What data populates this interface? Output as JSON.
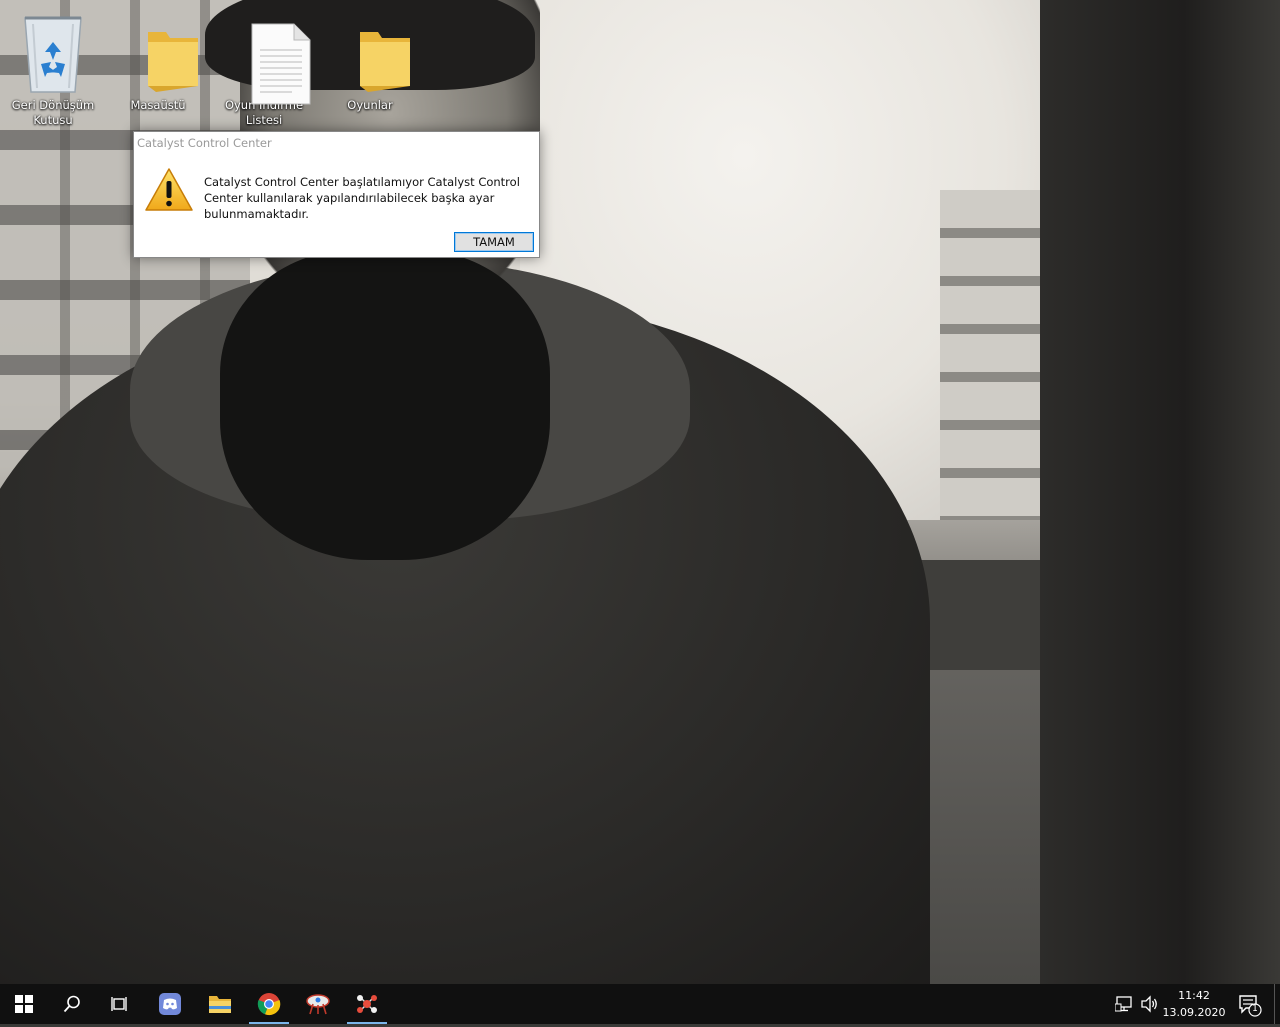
{
  "desktop": {
    "icons": [
      {
        "label": "Geri Dönüşüm Kutusu",
        "icon": "recycle-bin-icon"
      },
      {
        "label": "Masaüstü",
        "icon": "folder-icon"
      },
      {
        "label": "Oyun İndirme Listesi",
        "icon": "text-document-icon"
      },
      {
        "label": "Oyunlar",
        "icon": "folder-icon"
      }
    ]
  },
  "dialog": {
    "title": "Catalyst Control Center",
    "message": "Catalyst Control Center başlatılamıyor Catalyst Control Center kullanılarak yapılandırılabilecek başka ayar bulunmamaktadır.",
    "icon": "warning-icon",
    "ok_label": "TAMAM"
  },
  "taskbar": {
    "buttons": [
      {
        "name": "start",
        "icon": "windows-logo-icon"
      },
      {
        "name": "search",
        "icon": "search-icon"
      },
      {
        "name": "task-view",
        "icon": "task-view-icon"
      },
      {
        "name": "discord",
        "icon": "discord-icon"
      },
      {
        "name": "file-explorer",
        "icon": "folder-icon"
      },
      {
        "name": "chrome",
        "icon": "chrome-icon",
        "active": true
      },
      {
        "name": "app-satellite",
        "icon": "satellite-app-icon"
      },
      {
        "name": "app-molecule",
        "icon": "molecule-app-icon",
        "active": true
      }
    ],
    "tray": {
      "time": "11:42",
      "date": "13.09.2020",
      "notification_count": "1"
    }
  },
  "colors": {
    "taskbar_bg": "#101010",
    "active_indicator": "#7ab5ea",
    "dialog_button_border": "#0078d7",
    "folder_yellow": "#f2c84b"
  }
}
